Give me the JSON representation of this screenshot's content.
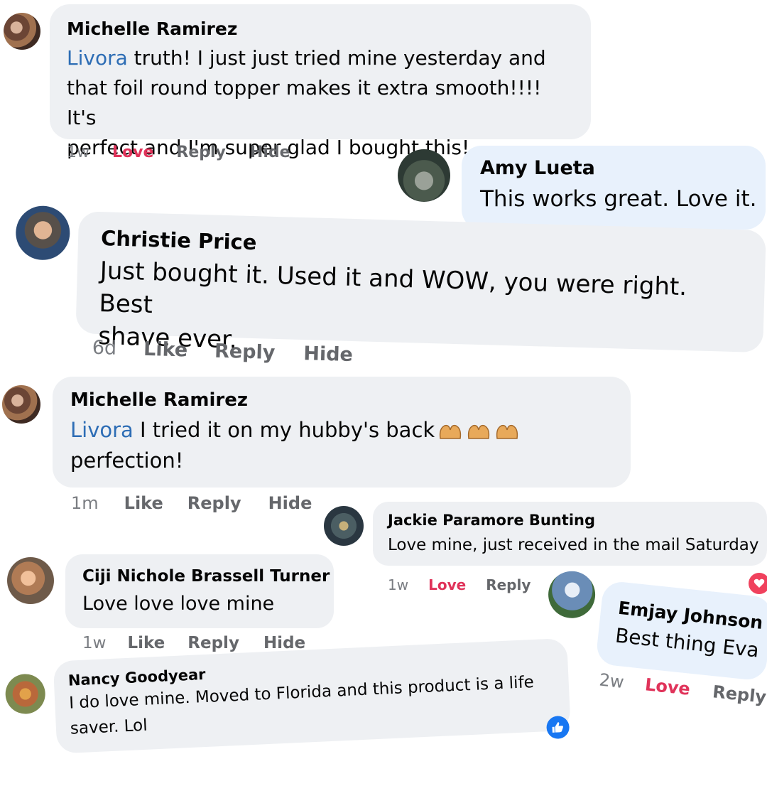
{
  "comments": [
    {
      "author": "Michelle Ramirez",
      "mention": "Livora",
      "text_lines": [
        " truth! I just just tried mine yesterday and",
        "that foil round topper makes it extra smooth!!!! It's",
        "perfect and I'm super glad I bought this!"
      ],
      "time": "1w",
      "reaction": "Love",
      "reply": "Reply",
      "hide": "Hide"
    },
    {
      "author": "Amy Lueta",
      "text": "This works great. Love it."
    },
    {
      "author": "Christie Price",
      "text_lines": [
        "Just bought it. Used it and WOW, you were right. Best",
        "shave ever."
      ],
      "time": "6d",
      "reaction": "Like",
      "reply": "Reply",
      "hide": "Hide"
    },
    {
      "author": "Michelle Ramirez",
      "mention": "Livora",
      "text_lines": [
        " I tried it on my hubby's back",
        "perfection!"
      ],
      "emoji": "raising-hands-emoji",
      "time": "1m",
      "reaction": "Like",
      "reply": "Reply",
      "hide": "Hide"
    },
    {
      "author": "Jackie Paramore Bunting",
      "text": "Love mine, just received in the mail Saturday",
      "time": "1w",
      "reaction": "Love",
      "reply": "Reply",
      "badge_icon": "heart-reaction-icon"
    },
    {
      "author": "Ciji Nichole Brassell Turner",
      "text": "Love love love mine",
      "time": "1w",
      "reaction": "Like",
      "reply": "Reply",
      "hide": "Hide"
    },
    {
      "author": "Emjay Johnson",
      "text": "Best thing Eva",
      "time": "2w",
      "reaction": "Love",
      "reply": "Reply"
    },
    {
      "author": "Nancy Goodyear",
      "text_lines": [
        "I do love mine. Moved to Florida and this product is a life",
        "saver. Lol"
      ],
      "badge_icon": "like-reaction-icon"
    }
  ],
  "colors": {
    "bubble": "#eef0f3",
    "bubble_blue": "#e8f1fc",
    "mention": "#2d6db5",
    "love": "#e0335a",
    "action": "#65676b",
    "like_badge": "#1877f2",
    "heart_badge": "#f0415d"
  }
}
